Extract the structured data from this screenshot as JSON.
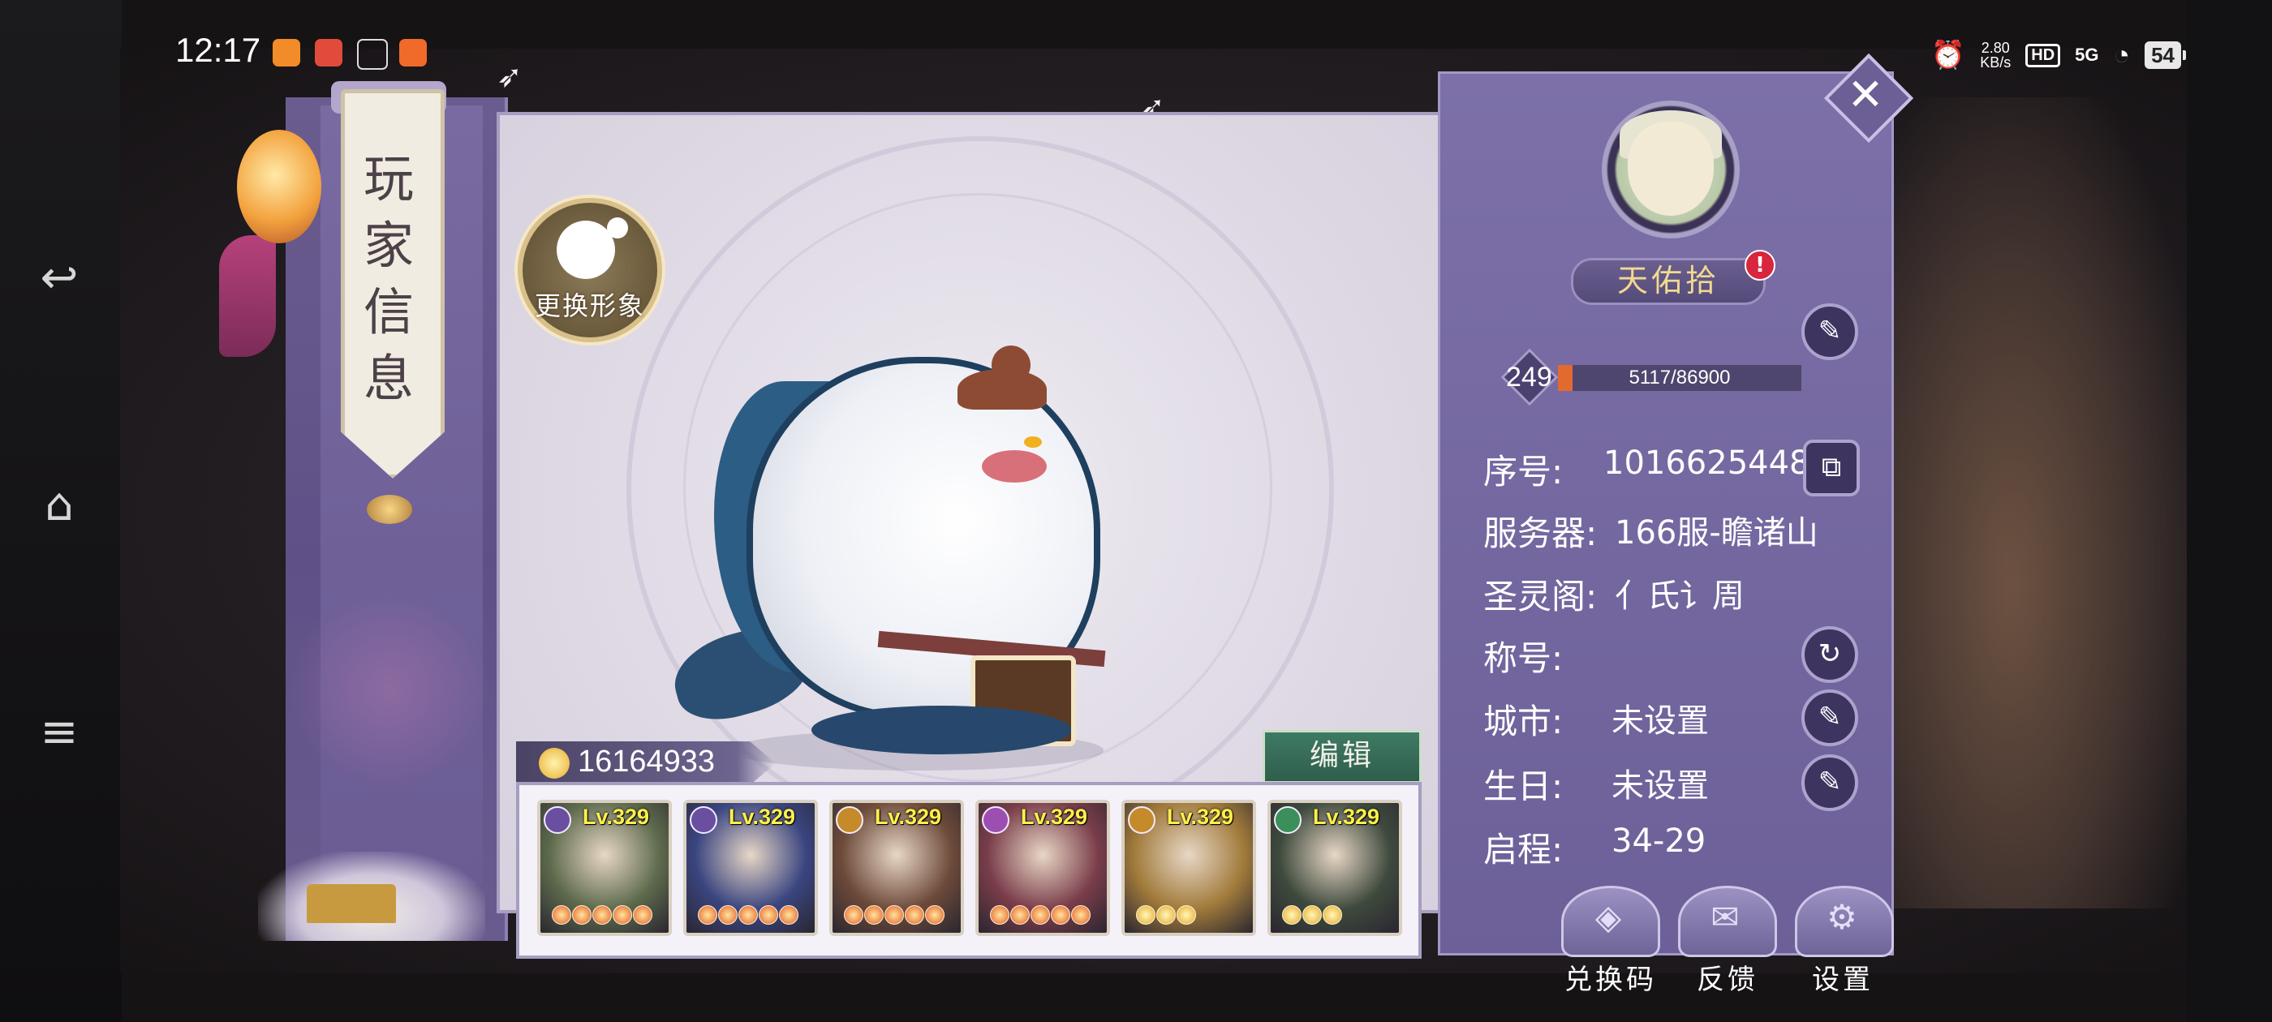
{
  "status_bar": {
    "time": "12:17",
    "net_speed_value": "2.80",
    "net_speed_unit": "KB/s",
    "hd": "HD",
    "signal": "5G",
    "battery": "54"
  },
  "nav": {
    "back_icon": "back-arrow-icon",
    "home_icon": "home-icon",
    "menu_icon": "menu-icon"
  },
  "panel_title": "玩家信息",
  "change_look_label": "更换形象",
  "power": "16164933",
  "edit_label": "编辑",
  "team": [
    {
      "level": "Lv.329",
      "element_color": "#6a4fa1",
      "stars": 5,
      "portrait_color": "#5d6a4c"
    },
    {
      "level": "Lv.329",
      "element_color": "#6a4fa1",
      "stars": 5,
      "portrait_color": "#3a4580"
    },
    {
      "level": "Lv.329",
      "element_color": "#c58b2b",
      "stars": 5,
      "portrait_color": "#6d4a3a"
    },
    {
      "level": "Lv.329",
      "element_color": "#9d4fb1",
      "stars": 5,
      "portrait_color": "#7a3d4a"
    },
    {
      "level": "Lv.329",
      "element_color": "#c58b2b",
      "stars": 3,
      "portrait_color": "#a07a3a"
    },
    {
      "level": "Lv.329",
      "element_color": "#3b8f5a",
      "stars": 3,
      "portrait_color": "#3e4a3d"
    }
  ],
  "player": {
    "name": "天佑拾",
    "alert": "!",
    "level": "249",
    "exp_text": "5117/86900",
    "exp_fraction": 0.0589,
    "id_label": "序号:",
    "id_value": "10166254484",
    "server_label": "服务器:",
    "server_value": "166服-瞻诸山",
    "guild_label": "圣灵阁:",
    "guild_value": "亻氏讠周",
    "title_label": "称号:",
    "city_label": "城市:",
    "city_value": "未设置",
    "birthday_label": "生日:",
    "birthday_value": "未设置",
    "journey_label": "启程:",
    "journey_value": "34-29"
  },
  "bottom_buttons": {
    "redeem": "兑换码",
    "feedback": "反馈",
    "settings": "设置"
  }
}
